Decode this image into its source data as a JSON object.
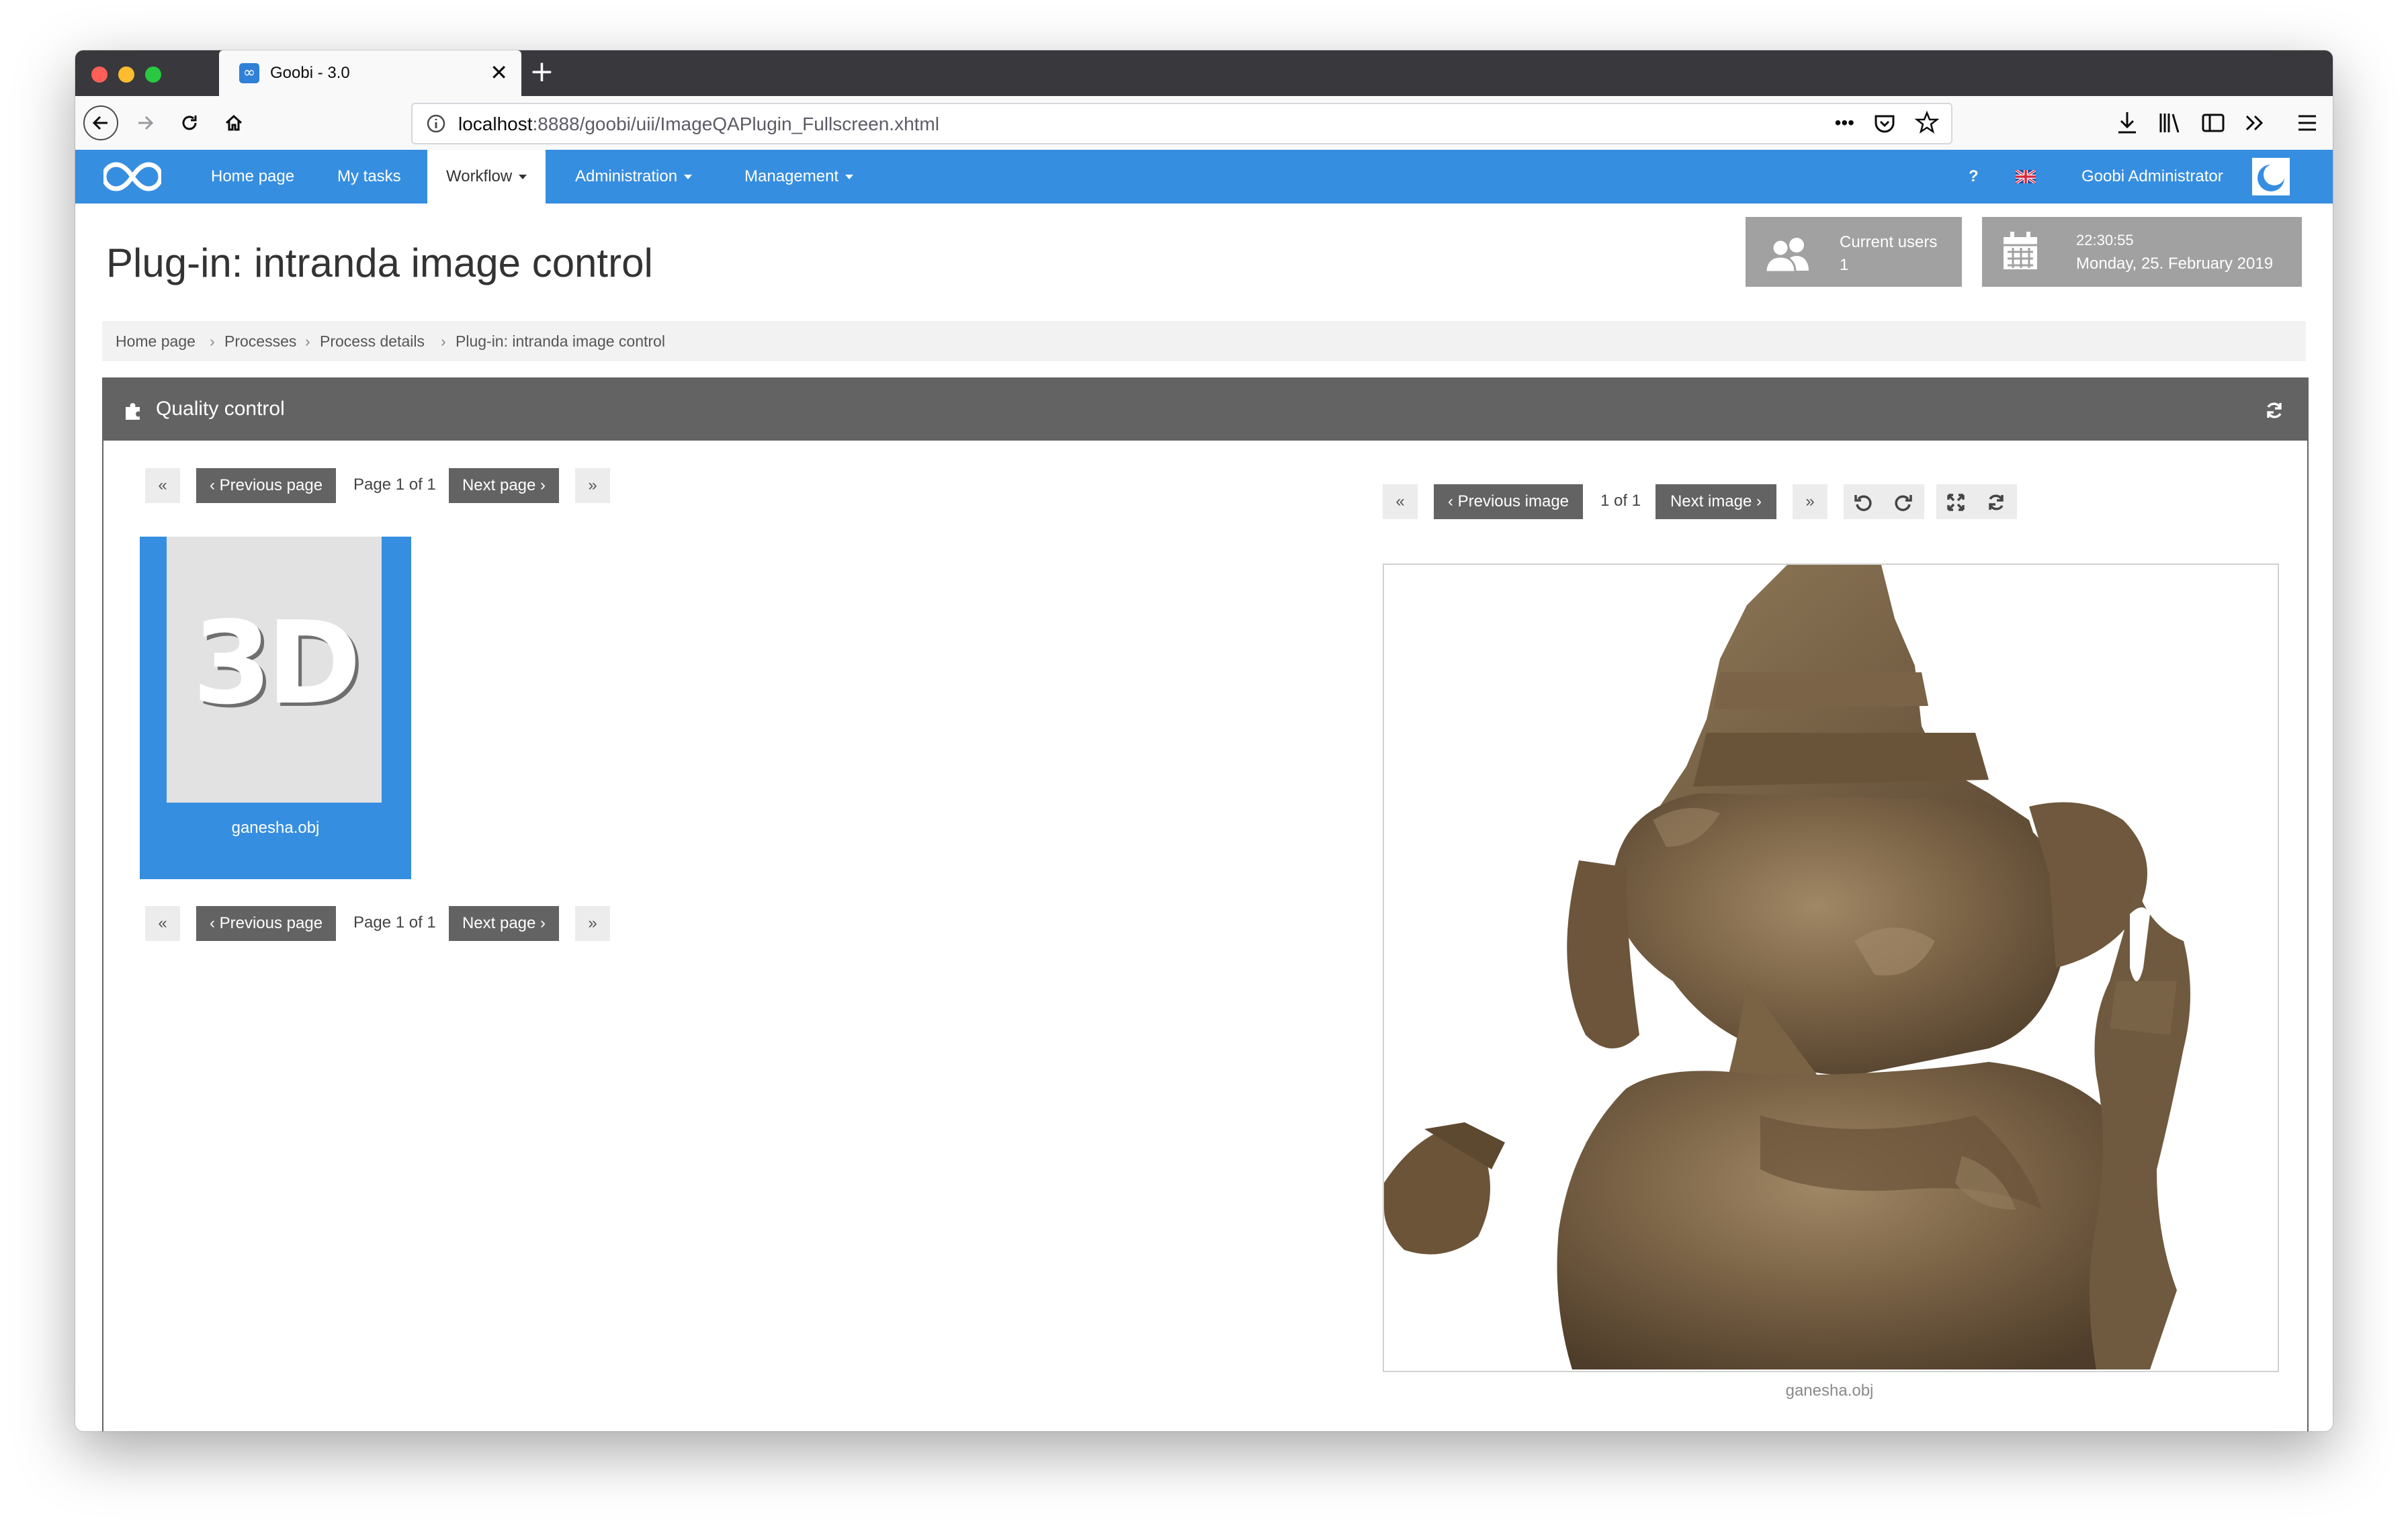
{
  "browser": {
    "tab_title": "Goobi - 3.0",
    "tab_favicon": "∞",
    "tab_close": "✕",
    "new_tab": "+",
    "url_host": "localhost",
    "url_rest": ":8888/goobi/uii/ImageQAPlugin_Fullscreen.xhtml",
    "url_more": "•••"
  },
  "navbar": {
    "items": [
      {
        "label": "Home page"
      },
      {
        "label": "My tasks"
      },
      {
        "label": "Workflow"
      },
      {
        "label": "Administration"
      },
      {
        "label": "Management"
      }
    ],
    "help": "?",
    "user": "Goobi Administrator",
    "color": "#368ee0"
  },
  "page": {
    "title": "Plug-in: intranda image control"
  },
  "stats": {
    "users_label": "Current users",
    "users_count": "1",
    "time": "22:30:55",
    "date": "Monday, 25. February 2019"
  },
  "breadcrumb": [
    "Home page",
    "Processes",
    "Process details",
    "Plug-in: intranda image control"
  ],
  "breadcrumb_sep": "›",
  "panel": {
    "title": "Quality control"
  },
  "pagination": {
    "first": "«",
    "prev": "‹ Previous page",
    "info": "Page 1 of 1",
    "next": "Next page ›",
    "last": "»"
  },
  "viewer_nav": {
    "first": "«",
    "prev": "‹ Previous image",
    "info": "1 of 1",
    "next": "Next image ›",
    "last": "»"
  },
  "thumbnail": {
    "placeholder": "3D",
    "filename": "ganesha.obj"
  },
  "viewer": {
    "caption": "ganesha.obj"
  }
}
